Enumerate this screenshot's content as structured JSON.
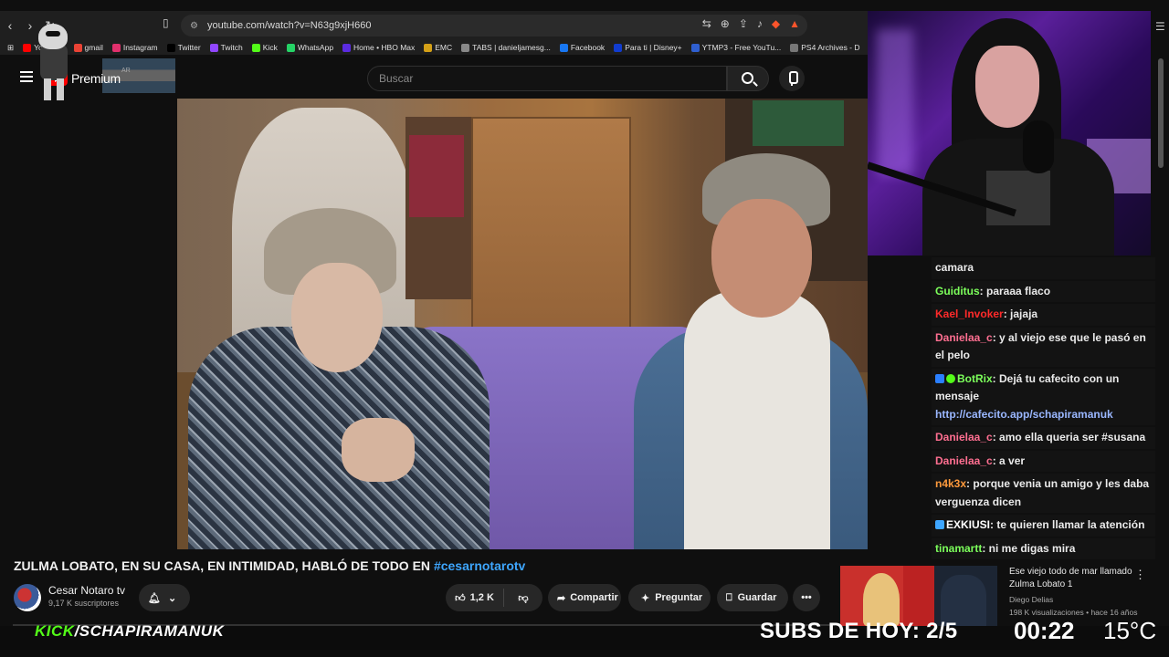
{
  "browser": {
    "url": "youtube.com/watch?v=N63g9xjH660",
    "bookmarks": [
      {
        "label": "YouTube",
        "color": "#ff0000"
      },
      {
        "label": "gmail",
        "color": "#ea4335"
      },
      {
        "label": "Instagram",
        "color": "#e1306c"
      },
      {
        "label": "Twitter",
        "color": "#000000"
      },
      {
        "label": "Twitch",
        "color": "#9146ff"
      },
      {
        "label": "Kick",
        "color": "#53fc18"
      },
      {
        "label": "WhatsApp",
        "color": "#25d366"
      },
      {
        "label": "Home • HBO Max",
        "color": "#5b2be0"
      },
      {
        "label": "EMC",
        "color": "#d4a017"
      },
      {
        "label": "TABS | danieljamesg...",
        "color": "#888888"
      },
      {
        "label": "Facebook",
        "color": "#1877f2"
      },
      {
        "label": "Para ti | Disney+",
        "color": "#113ccf"
      },
      {
        "label": "YTMP3 - Free YouTu...",
        "color": "#2f5fd0"
      },
      {
        "label": "PS4 Archives - D",
        "color": "#777777"
      }
    ]
  },
  "youtube": {
    "logo_text": "Premium",
    "country_code": "AR",
    "search_placeholder": "Buscar"
  },
  "video": {
    "title": "ZULMA LOBATO, EN SU CASA, EN INTIMIDAD, HABLÓ DE TODO EN",
    "hashtag": "#cesarnotarotv",
    "channel_name": "Cesar Notaro tv",
    "subscribers": "9,17 K suscriptores",
    "likes": "1,2 K",
    "share_label": "Compartir",
    "ask_label": "Preguntar",
    "save_label": "Guardar"
  },
  "recommended": {
    "title": "Ese viejo todo de mar llamado Zulma Lobato 1",
    "channel": "Diego Delias",
    "meta": "198 K visualizaciones • hace 16 años"
  },
  "chat": [
    {
      "user": "",
      "color": "#ffffff",
      "text": "camara"
    },
    {
      "user": "Guiditus",
      "color": "#7cff5b",
      "text": ": paraaa flaco"
    },
    {
      "user": "Kael_Invoker",
      "color": "#ff2a2a",
      "text": ": jajaja"
    },
    {
      "user": "Danielaa_c",
      "color": "#ff6f91",
      "text": ": y al viejo ese que le pasó en el pelo"
    },
    {
      "user": "BotRix",
      "color": "#7cff5b",
      "text": ": Dejá tu cafecito con un mensaje",
      "link": "http://cafecito.app/schapiramanuk",
      "badges": true
    },
    {
      "user": "Danielaa_c",
      "color": "#ff6f91",
      "text": ": amo ella queria ser #susana"
    },
    {
      "user": "Danielaa_c",
      "color": "#ff6f91",
      "text": ": a ver"
    },
    {
      "user": "n4k3x",
      "color": "#ff9a3c",
      "text": ": porque venia un amigo y les daba verguenza dicen"
    },
    {
      "user": "EXKIUSI",
      "color": "#ffffff",
      "text": ": te quieren llamar la atención",
      "badge_blue": true
    },
    {
      "user": "tinamartt",
      "color": "#7cff5b",
      "text": ": ni me digas mira"
    }
  ],
  "overlay": {
    "kick_word": "KICK",
    "kick_user": "/SCHAPIRAMANUK",
    "subs_goal": "SUBS DE HOY: 2/5",
    "clock": "00:22",
    "temperature": "15°C"
  },
  "colors": {
    "kick_green": "#53fc18",
    "hashtag_blue": "#3ea6ff",
    "yt_red": "#ff0000"
  }
}
